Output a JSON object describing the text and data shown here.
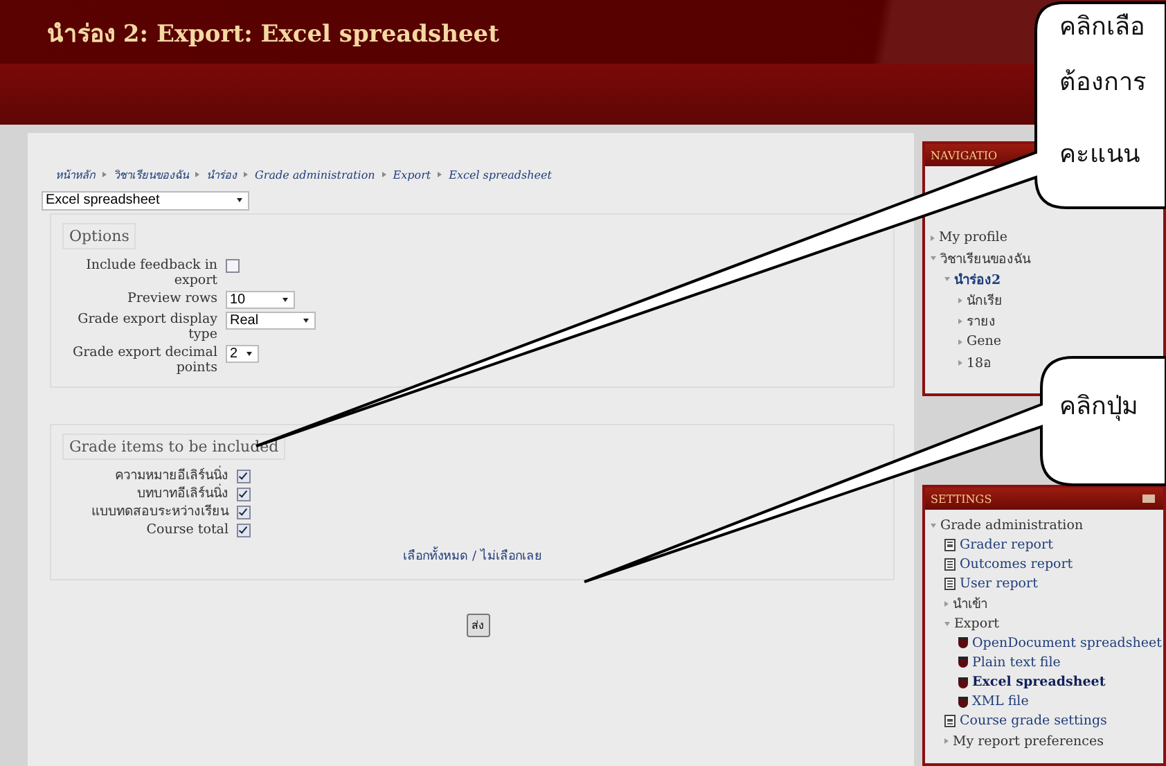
{
  "header": {
    "title": "นำร่อง 2: Export: Excel spreadsheet"
  },
  "breadcrumb": [
    {
      "label": "หน้าหลัก"
    },
    {
      "label": "วิชาเรียนของฉัน"
    },
    {
      "label": "นำร่อง"
    },
    {
      "label": "Grade administration"
    },
    {
      "label": "Export"
    },
    {
      "label": "Excel spreadsheet"
    }
  ],
  "export_format": {
    "value": "Excel spreadsheet"
  },
  "options": {
    "legend": "Options",
    "fields": [
      {
        "kind": "checkbox",
        "label": "Include feedback in export",
        "checked": false
      },
      {
        "kind": "select",
        "label": "Preview rows",
        "value": "10"
      },
      {
        "kind": "select",
        "label": "Grade export display type",
        "value": "Real"
      },
      {
        "kind": "select",
        "label": "Grade export decimal points",
        "value": "2"
      }
    ]
  },
  "grade_items": {
    "legend": "Grade items to be included",
    "items": [
      {
        "label": "ความหมายอีเลิร์นนิ่ง",
        "checked": true
      },
      {
        "label": "บทบาทอีเลิร์นนิ่ง",
        "checked": true
      },
      {
        "label": "แบบทดสอบระหว่างเรียน",
        "checked": true
      },
      {
        "label": "Course total",
        "checked": true
      }
    ],
    "select_links": "เลือกทั้งหมด / ไม่เลือกเลย"
  },
  "submit": "ส่ง",
  "navigation": {
    "title": "NAVIGATIO",
    "items": [
      {
        "label": "My profile",
        "expanded": false
      },
      {
        "label": "วิชาเรียนของฉัน",
        "expanded": true,
        "children": [
          {
            "label": "นำร่อง2",
            "expanded": true,
            "children": [
              {
                "label": "นักเรีย",
                "expanded": false
              },
              {
                "label": "รายง",
                "expanded": false
              },
              {
                "label": "Gene",
                "expanded": false
              },
              {
                "label": "18อ",
                "expanded": false
              }
            ]
          }
        ]
      }
    ]
  },
  "settings": {
    "title": "SETTINGS",
    "items": [
      {
        "kind": "branch",
        "label": "Grade administration",
        "expanded": true,
        "selected": false,
        "children": [
          {
            "kind": "page",
            "label": "Grader report",
            "selected": false
          },
          {
            "kind": "page",
            "label": "Outcomes report",
            "selected": false
          },
          {
            "kind": "page",
            "label": "User report",
            "selected": false
          },
          {
            "kind": "branch",
            "label": "นำเข้า",
            "expanded": false,
            "selected": false
          },
          {
            "kind": "branch",
            "label": "Export",
            "expanded": true,
            "selected": false,
            "children": [
              {
                "kind": "export",
                "label": "OpenDocument spreadsheet",
                "selected": false
              },
              {
                "kind": "export",
                "label": "Plain text file",
                "selected": false
              },
              {
                "kind": "export",
                "label": "Excel spreadsheet",
                "selected": true
              },
              {
                "kind": "export",
                "label": "XML file",
                "selected": false
              }
            ]
          },
          {
            "kind": "page",
            "label": "Course grade settings",
            "selected": false
          },
          {
            "kind": "branch",
            "label": "My report preferences",
            "expanded": false,
            "selected": false
          }
        ]
      }
    ]
  },
  "callouts": [
    {
      "lines": [
        "คลิกเลือ",
        "ต้องการ",
        "คะแนน"
      ]
    },
    {
      "lines": [
        "คลิกปุ่ม"
      ]
    }
  ]
}
